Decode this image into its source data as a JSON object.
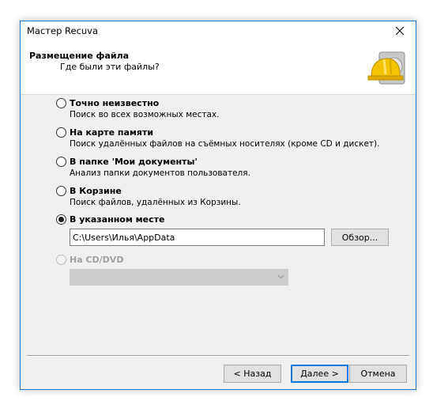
{
  "window": {
    "title": "Мастер Recuva"
  },
  "header": {
    "title": "Размещение файла",
    "subtitle": "Где были эти файлы?"
  },
  "options": [
    {
      "label": "Точно неизвестно",
      "description": "Поиск во всех возможных местах.",
      "selected": false,
      "enabled": true
    },
    {
      "label": "На карте памяти",
      "description": "Поиск удалённых файлов на съёмных носителях (кроме CD и дискет).",
      "selected": false,
      "enabled": true
    },
    {
      "label": "В папке 'Мои документы'",
      "description": "Анализ папки документов пользователя.",
      "selected": false,
      "enabled": true
    },
    {
      "label": "В Корзине",
      "description": "Поиск файлов, удалённых из Корзины.",
      "selected": false,
      "enabled": true
    },
    {
      "label": "В указанном месте",
      "selected": true,
      "enabled": true
    },
    {
      "label": "На CD/DVD",
      "selected": false,
      "enabled": false
    }
  ],
  "path_input": {
    "value": "C:\\Users\\Илья\\AppData"
  },
  "browse_button": {
    "label": "Обзор..."
  },
  "cd_combo": {
    "value": ""
  },
  "footer": {
    "back_label": "< Назад",
    "next_label": "Далее >",
    "cancel_label": "Отмена"
  },
  "colors": {
    "accent": "#0078d7",
    "window_border": "#1979ca",
    "disabled_text": "#a0a0a0"
  },
  "icons": {
    "close": "close-icon",
    "logo": "recuva-hardhat-disk-logo",
    "combo_arrow": "chevron-down-icon"
  }
}
